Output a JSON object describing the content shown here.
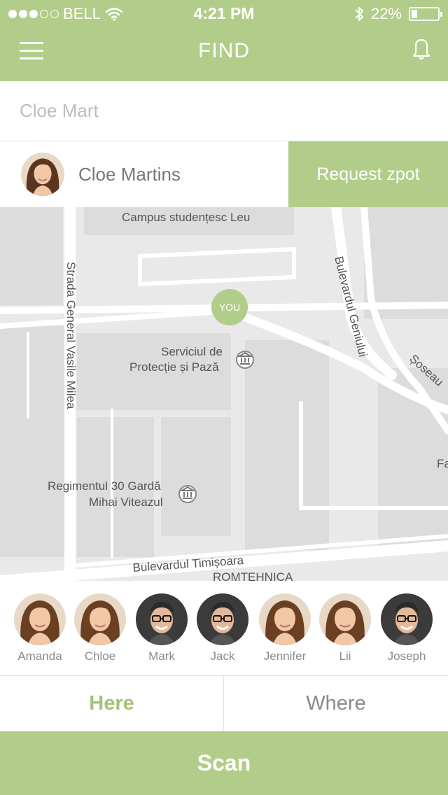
{
  "status_bar": {
    "carrier": "BELL",
    "time": "4:21 PM",
    "battery_percent": "22%",
    "battery_level": 0.22,
    "signal_dots_filled": 3,
    "signal_dots_total": 5,
    "icons": [
      "wifi-icon",
      "bluetooth-icon",
      "battery-icon"
    ]
  },
  "nav": {
    "title": "FIND",
    "menu_icon": "hamburger-icon",
    "bell_icon": "bell-icon"
  },
  "search": {
    "value": "Cloe Mart",
    "placeholder": ""
  },
  "result": {
    "name": "Cloe Martins",
    "button_label": "Request zpot"
  },
  "map": {
    "pin_label": "YOU",
    "labels": {
      "campus": "Campus studențesc Leu",
      "strada_general": "Strada General Vasile Milea",
      "bulevardul_geniului": "Bulevardul Geniului",
      "soseaua": "Șoseau",
      "fa": "Fa",
      "serviciul_1": "Serviciul de",
      "serviciul_2": "Protecție și Pază",
      "regimentul_1": "Regimentul 30 Gardă",
      "regimentul_2": "Mihai Viteazul",
      "timisoara": "Bulevardul Timișoara",
      "romtehnica": "ROMTEHNICA"
    }
  },
  "people": [
    {
      "name": "Amanda",
      "avatar": "woman"
    },
    {
      "name": "Chloe",
      "avatar": "woman"
    },
    {
      "name": "Mark",
      "avatar": "man"
    },
    {
      "name": "Jack",
      "avatar": "man"
    },
    {
      "name": "Jennifer",
      "avatar": "woman"
    },
    {
      "name": "Lii",
      "avatar": "woman"
    },
    {
      "name": "Joseph",
      "avatar": "man"
    }
  ],
  "tabs": {
    "here": "Here",
    "where": "Where"
  },
  "scan_label": "Scan",
  "colors": {
    "accent": "#b2cd89",
    "accent_text": "#a3c374",
    "map_bg": "#e9e9e9",
    "text_gray": "#8a8a8a"
  }
}
